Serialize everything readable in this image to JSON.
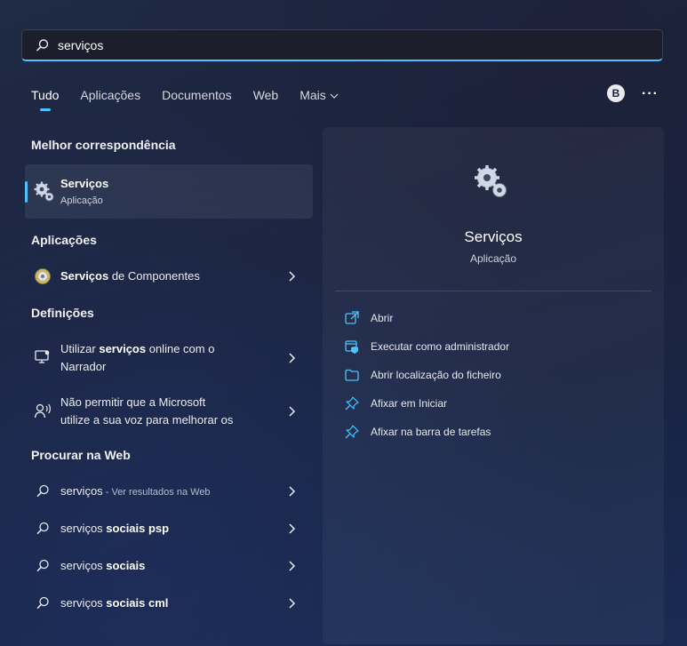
{
  "search": {
    "value": "serviços",
    "icon": "search-icon"
  },
  "tabs": [
    {
      "label": "Tudo",
      "active": true
    },
    {
      "label": "Aplicações"
    },
    {
      "label": "Documentos"
    },
    {
      "label": "Web"
    },
    {
      "label": "Mais"
    }
  ],
  "account": {
    "initial": "B"
  },
  "more_menu": "···",
  "sections": {
    "best_match": "Melhor correspondência",
    "apps": "Aplicações",
    "settings": "Definições",
    "web": "Procurar na Web"
  },
  "best_match": {
    "title": "Serviços",
    "subtitle": "Aplicação"
  },
  "apps": [
    {
      "bold": "Serviços",
      "rest": " de Componentes"
    }
  ],
  "settings": [
    {
      "pre": "Utilizar ",
      "bold": "serviços",
      "post": " online com o",
      "line2": "Narrador"
    },
    {
      "line1": "Não permitir que a Microsoft",
      "line2": "utilize a sua voz para melhorar os"
    }
  ],
  "web": [
    {
      "main": "serviços",
      "suffix": " - Ver resultados na Web"
    },
    {
      "main": "serviços ",
      "bold": "sociais psp"
    },
    {
      "main": "serviços ",
      "bold": "sociais"
    },
    {
      "main": "serviços ",
      "bold": "sociais cml"
    }
  ],
  "preview": {
    "title": "Serviços",
    "subtitle": "Aplicação",
    "actions": [
      {
        "label": "Abrir",
        "icon": "open-icon"
      },
      {
        "label": "Executar como administrador",
        "icon": "admin-icon"
      },
      {
        "label": "Abrir localização do ficheiro",
        "icon": "folder-icon"
      },
      {
        "label": "Afixar em Iniciar",
        "icon": "pin-icon"
      },
      {
        "label": "Afixar na barra de tarefas",
        "icon": "pin-icon"
      }
    ]
  },
  "colors": {
    "accent": "#4cc2ff"
  }
}
